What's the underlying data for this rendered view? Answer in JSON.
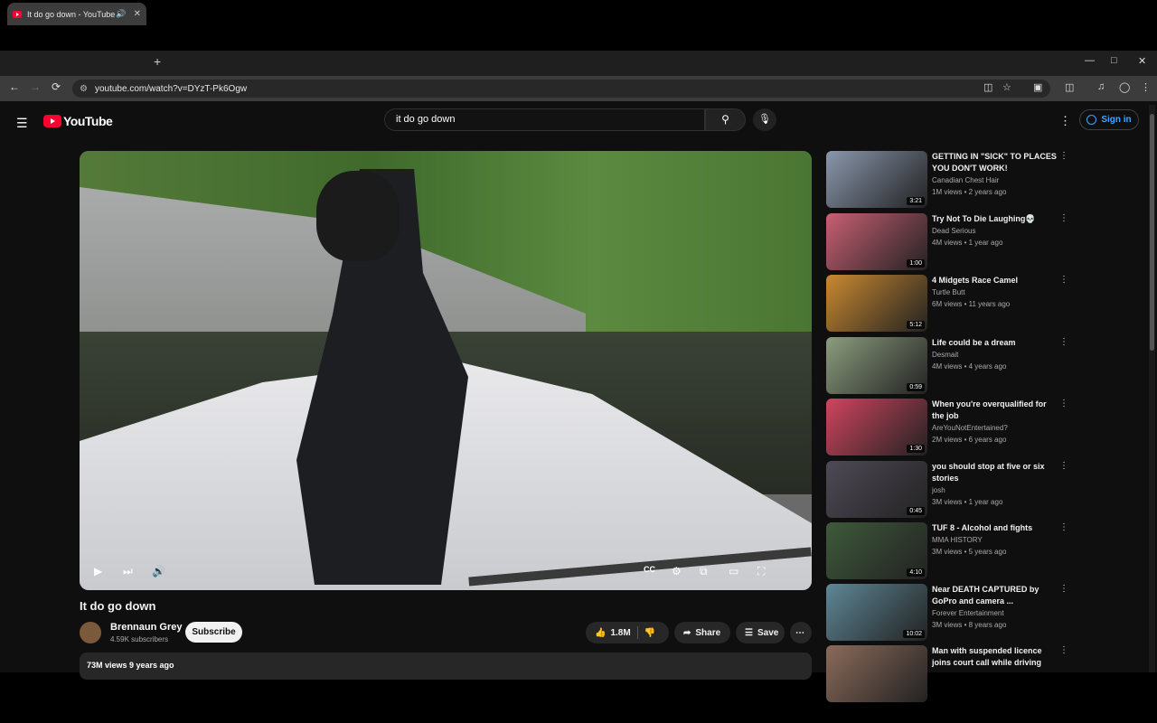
{
  "browser": {
    "tab_title": "It do go down - YouTube",
    "audio_icon": "🔊",
    "close_glyph": "✕",
    "newtab_glyph": "+",
    "url": "youtube.com/watch?v=DYzT-Pk6Ogw",
    "back": "←",
    "forward": "→",
    "reload": "⟳",
    "win_min": "—",
    "win_max": "□",
    "win_close": "✕"
  },
  "header": {
    "menu_glyph": "☰",
    "logo_text": "YouTube",
    "search_value": "it do go down",
    "search_glyph": "⚲",
    "mic_glyph": "🎙",
    "more_glyph": "⋮",
    "signin_label": "Sign in"
  },
  "video": {
    "title": "It do go down",
    "channel": "Brennaun Grey",
    "subscribers": "4.59K subscribers",
    "subscribe_label": "Subscribe",
    "likes": "1.8M",
    "like_glyph": "👍",
    "dislike_glyph": "👎",
    "share_label": "Share",
    "save_label": "Save",
    "more_glyph": "⋯",
    "views_line": "73M views  9 years ago",
    "controls": {
      "play": "▶",
      "next": "⏭",
      "volume": "🔊",
      "settings": "⚙",
      "miniplayer": "⧉",
      "theater": "▭",
      "fullscreen": "⛶",
      "cc": "CC"
    }
  },
  "recommendations": [
    {
      "title": "GETTING IN \"SICK\" TO PLACES YOU DON'T WORK!",
      "channel": "Canadian Chest Hair",
      "meta": "1M views • 2 years ago",
      "duration": "3:21",
      "color": "#8a97ac"
    },
    {
      "title": "Try Not To Die Laughing💀",
      "channel": "Dead Serious",
      "meta": "4M views • 1 year ago",
      "duration": "1:00",
      "color": "#c85f73"
    },
    {
      "title": "4 Midgets Race Camel",
      "channel": "Turtle Butt",
      "meta": "6M views • 11 years ago",
      "duration": "5:12",
      "color": "#c9892f"
    },
    {
      "title": "Life could be a dream",
      "channel": "Desmait",
      "meta": "4M views • 4 years ago",
      "duration": "0:59",
      "color": "#8c9d7e"
    },
    {
      "title": "When you're overqualified for the job",
      "channel": "AreYouNotEntertained?",
      "meta": "2M views • 6 years ago",
      "duration": "1:30",
      "color": "#d0445e"
    },
    {
      "title": "you should stop at five or six stories",
      "channel": "josh",
      "meta": "3M views • 1 year ago",
      "duration": "0:45",
      "color": "#4f4a56"
    },
    {
      "title": "TUF 8 - Alcohol and fights",
      "channel": "MMA HISTORY",
      "meta": "3M views • 5 years ago",
      "duration": "4:10",
      "color": "#3e5a3a"
    },
    {
      "title": "Near DEATH CAPTURED by GoPro and camera ...",
      "channel": "Forever Entertainment",
      "meta": "3M views • 8 years ago",
      "duration": "10:02",
      "color": "#5e8796"
    },
    {
      "title": "Man with suspended licence joins court call while driving",
      "channel": "",
      "meta": "",
      "duration": "",
      "color": "#8b6b5a"
    }
  ],
  "rec_more_glyph": "⋮"
}
